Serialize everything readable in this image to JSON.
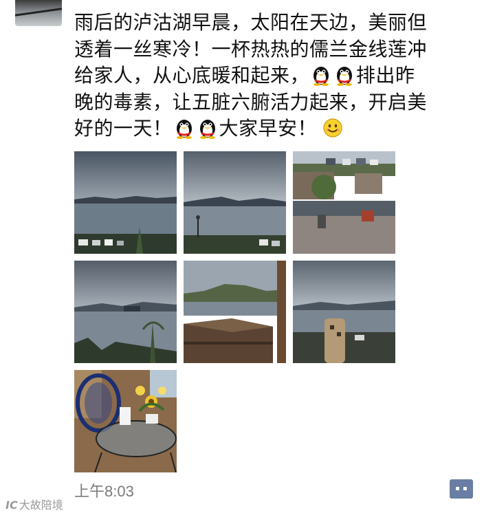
{
  "post": {
    "text_lines": [
      "雨后的泸沽湖早晨，太阳在天边，美丽但",
      "透着一丝寒冷！一杯热热的儒兰金线莲冲",
      "给家人，从心底暖和起来，",
      "排出昨",
      "晚的毒素，让五脏六腑活力起来，开启美",
      "好的一天！",
      "大家早安！"
    ],
    "emoji": [
      "penguin-icon",
      "penguin-icon",
      "penguin-icon",
      "penguin-icon",
      "smiley-icon"
    ],
    "photos": [
      "lake-morning-photo",
      "lake-shore-photo",
      "courtyard-photo",
      "lake-island-photo",
      "rooftop-lake-photo",
      "lake-tower-photo",
      "flower-table-photo"
    ],
    "timestamp": "上午8:03"
  },
  "watermark": {
    "logo": "IC",
    "text": "大故陪境"
  },
  "colors": {
    "text": "#111111",
    "timestamp": "#7a7a7a",
    "comment_button": "#6a7ea3"
  }
}
